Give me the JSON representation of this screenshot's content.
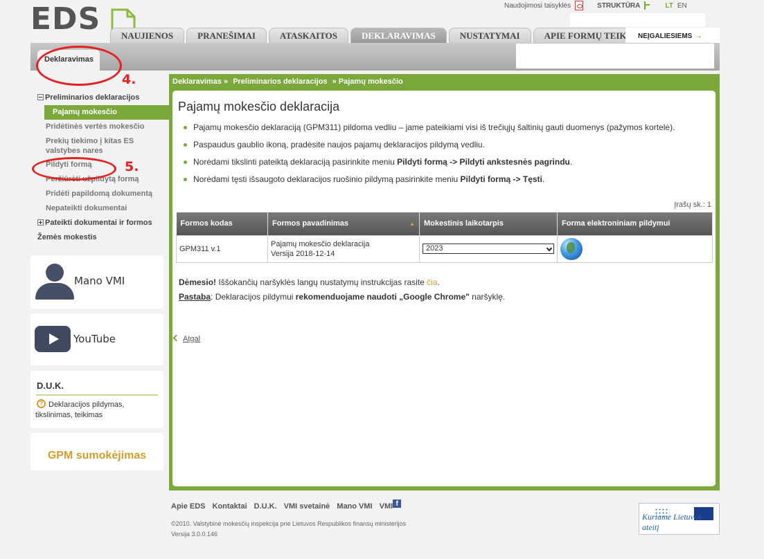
{
  "brand": {
    "logo_text": "EDS"
  },
  "toplinks": {
    "rules": "Naudojimosi taisyklės",
    "structure": "STRUKTŪRA",
    "lang_lt": "LT",
    "lang_en": "EN"
  },
  "tabs": [
    "NAUJIENOS",
    "PRANEŠIMAI",
    "ATASKAITOS",
    "DEKLARAVIMAS",
    "NUSTATYMAI",
    "APIE FORMŲ TEIKIMĄ"
  ],
  "accessibility": {
    "label": "NEĮGALIESIEMS",
    "arrow": "→"
  },
  "subtab": "Deklaravimas",
  "annotations": {
    "step4": "4.",
    "step5": "5."
  },
  "leftmenu": {
    "prelim": "Preliminarios deklaracijos",
    "income": "Pajamų mokesčio",
    "vat": "Pridėtinės vertės mokesčio",
    "goods": "Prekių tiekimo į kitas ES valstybes nares",
    "fill": "Pildyti formą",
    "overview": "Peržiūrėti užpildytą formą",
    "attach": "Pridėti papildomą dokumentą",
    "unsubmitted": "Nepateikti dokumentai",
    "submitted": "Pateikti dokumentai ir formos",
    "land": "Žemės mokestis"
  },
  "cards": {
    "manovmi": "Mano VMI",
    "youtube": "YouTube",
    "duk_title": "D.U.K.",
    "duk_icon": "?",
    "duk_text": "Deklaracijos pildymas, tikslinimas, teikimas",
    "gpm": "GPM sumokėjimas"
  },
  "breadcrumb": [
    "Deklaravimas »",
    "Preliminarios deklaracijos",
    "» Pajamų mokesčio"
  ],
  "main": {
    "title": "Pajamų mokesčio deklaracija",
    "bullet1": "Pajamų mokesčio deklaraciją (GPM311) pildoma vedliu – jame pateikiami visi iš trečiųjų šaltinių gauti duomenys (pažymos kortelė).",
    "bullet2": "Paspaudus gaublio ikoną, pradėsite naujos pajamų deklaracijos pildymą vedliu.",
    "bullet3_pre": "Norėdami tikslinti pateiktą deklaraciją pasirinkite meniu ",
    "bullet3_bold": "Pildyti formą -> Pildyti ankstesnės pagrindu",
    "bullet3_post": ".",
    "bullet4_pre": "Norėdami tęsti išsaugoto deklaracijos ruošinio pildymą pasirinkite meniu ",
    "bullet4_bold": "Pildyti formą -> Tęsti",
    "bullet4_post": ".",
    "records": "Įrašų sk.: 1"
  },
  "table": {
    "headers": [
      "Formos kodas",
      "Formos pavadinimas",
      "Mokestinis laikotarpis",
      "Forma elektroniniam pildymui"
    ],
    "sort_indicator": "▲",
    "row": {
      "code": "GPM311 v.1",
      "name": "Pajamų mokesčio deklaracija",
      "version": "Versija 2018-12-14",
      "period": "2023"
    }
  },
  "notes": {
    "attention_label": "Dėmesio!",
    "attention_text": " Iššokančių naršyklės langų nustatymų instrukcijas rasite ",
    "attention_link": "čia",
    "attention_end": ".",
    "note_label": "Pastaba",
    "note_text1": ": Deklaracijos pildymui ",
    "note_bold": "rekomenduojame naudoti „Google Chrome\"",
    "note_text2": " naršyklę."
  },
  "back": "Atgal",
  "footer": {
    "links": [
      "Apie EDS",
      "Kontaktai",
      "D.U.K.",
      "VMI svetainė",
      "Mano VMI",
      "VMI"
    ],
    "fb": "f",
    "copyright": "©2010. Valstybinė mokesčių inspekcija prie Lietuvos Respublikos finansų ministerijos",
    "version": "Versija 3.0.0.146",
    "eu_slogan": "Kuriame Lietuvos ateitį"
  },
  "colors": {
    "accent": "#7aa83a",
    "link_gold": "#d39e2a",
    "annotation": "#e52020"
  }
}
